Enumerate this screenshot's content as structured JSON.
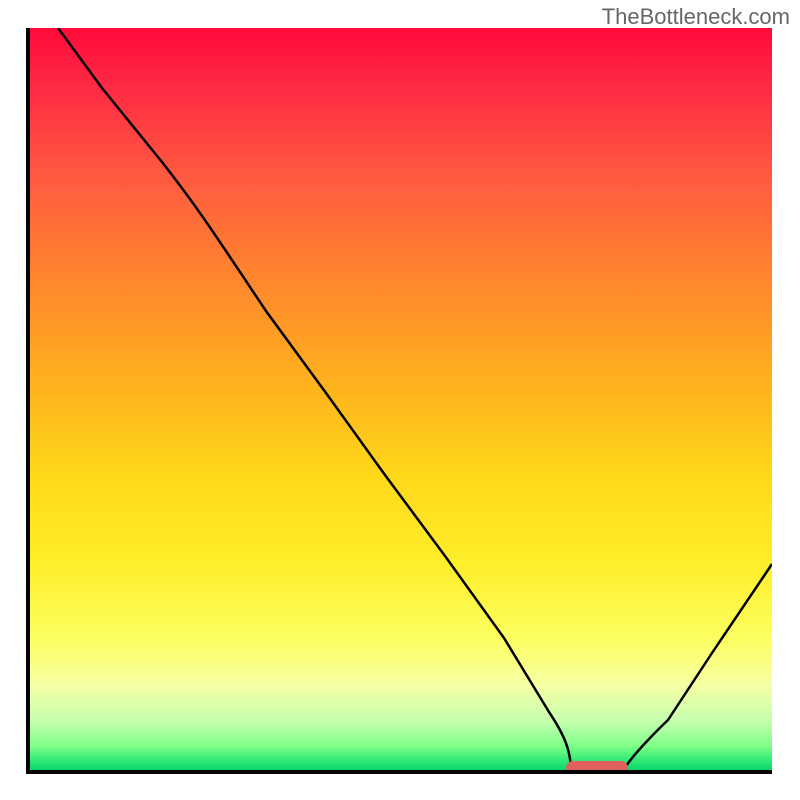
{
  "watermark": "TheBottleneck.com",
  "chart_data": {
    "type": "line",
    "title": "",
    "xlabel": "",
    "ylabel": "",
    "xlim": [
      0,
      100
    ],
    "ylim": [
      0,
      100
    ],
    "series": [
      {
        "name": "curve",
        "x": [
          4,
          10,
          18,
          25,
          32,
          40,
          48,
          56,
          64,
          70,
          73,
          77,
          80,
          86,
          92,
          100
        ],
        "values": [
          100,
          92,
          82,
          73,
          62,
          51,
          40,
          29,
          18,
          8,
          3,
          0,
          0,
          7,
          16,
          28
        ]
      }
    ],
    "marker": {
      "x_start": 73,
      "x_end": 80,
      "y": 0
    },
    "gradient_colors": {
      "top": "#ff0a3a",
      "mid_upper": "#ffb21e",
      "mid": "#ffee2a",
      "lower": "#c8ffb0",
      "bottom": "#00d36a"
    }
  }
}
